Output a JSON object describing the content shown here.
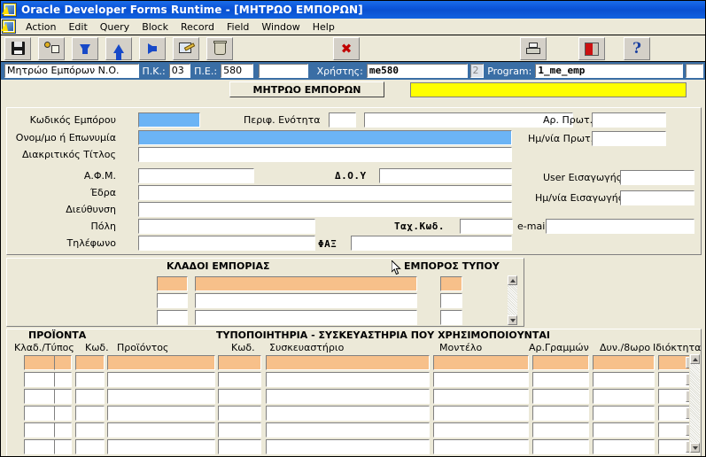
{
  "window": {
    "title": "Oracle Developer Forms Runtime - [ΜΗΤΡΩΟ ΕΜΠΟΡΩΝ]",
    "app_icon": "oracle-forms-icon"
  },
  "menubar": {
    "items": [
      {
        "label": "Action"
      },
      {
        "label": "Edit"
      },
      {
        "label": "Query"
      },
      {
        "label": "Block"
      },
      {
        "label": "Record"
      },
      {
        "label": "Field"
      },
      {
        "label": "Window"
      },
      {
        "label": "Help"
      }
    ]
  },
  "toolbar": {
    "buttons": [
      {
        "name": "save-button",
        "icon": "floppy-disk-icon"
      },
      {
        "name": "enter-query-button",
        "icon": "query-icon"
      },
      {
        "name": "next-record-button",
        "icon": "arrow-down-icon"
      },
      {
        "name": "previous-record-button",
        "icon": "arrow-up-icon"
      },
      {
        "name": "next-block-button",
        "icon": "arrow-right-icon"
      },
      {
        "name": "edit-button",
        "icon": "edit-pencil-icon"
      },
      {
        "name": "delete-record-button",
        "icon": "trash-icon"
      },
      {
        "name": "cancel-button",
        "icon": "red-x-icon"
      },
      {
        "name": "print-button",
        "icon": "printer-icon"
      },
      {
        "name": "exit-button",
        "icon": "exit-door-icon"
      },
      {
        "name": "help-button",
        "icon": "question-mark-icon"
      }
    ]
  },
  "statusbar": {
    "form_name": "Μητρώο Εμπόρων Ν.Ο.",
    "pk_label": "Π.Κ.:",
    "pk_value": "03",
    "pe_label": "Π.Ε.:",
    "pe_value": "580",
    "extra_value": "",
    "user_label": "Χρήστης:",
    "user_value": "me580",
    "seq_value": "2",
    "program_label": "Program:",
    "program_value": "1_me_emp",
    "tail_value": ""
  },
  "tab": {
    "label": "ΜΗΤΡΩΟ ΕΜΠΟΡΩΝ",
    "message_value": "",
    "message_color": "#ffff00"
  },
  "merchant": {
    "fields": [
      {
        "name": "merchant-code",
        "label": "Κωδικός Εμπόρου",
        "value": ""
      },
      {
        "name": "full-name",
        "label": "Ονομ/μο ή Επωνυμία",
        "value": ""
      },
      {
        "name": "distinctive-title",
        "label": "Διακριτικός Τίτλος",
        "value": ""
      },
      {
        "name": "afm",
        "label": "Α.Φ.Μ.",
        "value": ""
      },
      {
        "name": "headquarters",
        "label": "Έδρα",
        "value": ""
      },
      {
        "name": "address",
        "label": "Διεύθυνση",
        "value": ""
      },
      {
        "name": "city",
        "label": "Πόλη",
        "value": ""
      },
      {
        "name": "phone",
        "label": "Τηλέφωνο",
        "value": ""
      }
    ],
    "region_label": "Περιφ. Ενότητα",
    "region_code": "",
    "region_name": "",
    "doy_label": "Δ.Ο.Υ",
    "doy_value": "",
    "postal_label": "Ταχ.Κωδ.",
    "postal_value": "",
    "fax_label": "ΦΑΞ",
    "fax_value": "",
    "protocol_no_label": "Αρ. Πρωτ.",
    "protocol_no_value": "",
    "protocol_date_label": "Ημ/νία Πρωτ.",
    "protocol_date_value": "",
    "entry_user_label": "User Εισαγωγής",
    "entry_user_value": "",
    "entry_date_label": "Ημ/νία Εισαγωγής",
    "entry_date_value": "",
    "email_label": "e-mail",
    "email_value": ""
  },
  "branches": {
    "title": "ΚΛΑΔΟΙ ΕΜΠΟΡΙΑΣ",
    "press_title": "ΕΜΠΟΡΟΣ ΤΥΠΟΥ",
    "rows": [
      {
        "code": "",
        "description": "",
        "press": "",
        "current": true
      },
      {
        "code": "",
        "description": "",
        "press": "",
        "current": false
      },
      {
        "code": "",
        "description": "",
        "press": "",
        "current": false
      }
    ]
  },
  "products": {
    "section_title": "ΠΡΟΪΟΝΤΑ",
    "packaging_title": "ΤΥΠΟΠΟΙΗΤΗΡΙΑ - ΣΥΣΚΕΥΑΣΤΗΡΙΑ ΠΟΥ ΧΡΗΣΙΜΟΠΟΙΟΥΝΤΑΙ",
    "columns": [
      {
        "name": "col-branch-type",
        "label": "Κλαδ./Τύπος"
      },
      {
        "name": "col-code",
        "label": "Κωδ."
      },
      {
        "name": "col-product",
        "label": "Προϊόντος"
      },
      {
        "name": "col-pack-code",
        "label": "Κωδ."
      },
      {
        "name": "col-packer",
        "label": "Συσκευαστήριο"
      },
      {
        "name": "col-model",
        "label": "Μοντέλο"
      },
      {
        "name": "col-lines",
        "label": "Αρ.Γραμμών"
      },
      {
        "name": "col-capacity",
        "label": "Δυν./8ωρο"
      },
      {
        "name": "col-ownership",
        "label": "Ιδιόκτητα"
      }
    ],
    "rows": [
      {
        "branch_type": "",
        "code2": "",
        "code": "",
        "product": "",
        "pack_code": "",
        "packer": "",
        "model": "",
        "lines": "",
        "capacity": "",
        "ownership": "",
        "current": true
      },
      {
        "branch_type": "",
        "code2": "",
        "code": "",
        "product": "",
        "pack_code": "",
        "packer": "",
        "model": "",
        "lines": "",
        "capacity": "",
        "ownership": "",
        "current": false
      },
      {
        "branch_type": "",
        "code2": "",
        "code": "",
        "product": "",
        "pack_code": "",
        "packer": "",
        "model": "",
        "lines": "",
        "capacity": "",
        "ownership": "",
        "current": false
      },
      {
        "branch_type": "",
        "code2": "",
        "code": "",
        "product": "",
        "pack_code": "",
        "packer": "",
        "model": "",
        "lines": "",
        "capacity": "",
        "ownership": "",
        "current": false
      },
      {
        "branch_type": "",
        "code2": "",
        "code": "",
        "product": "",
        "pack_code": "",
        "packer": "",
        "model": "",
        "lines": "",
        "capacity": "",
        "ownership": "",
        "current": false
      },
      {
        "branch_type": "",
        "code2": "",
        "code": "",
        "product": "",
        "pack_code": "",
        "packer": "",
        "model": "",
        "lines": "",
        "capacity": "",
        "ownership": "",
        "current": false
      }
    ]
  },
  "colors": {
    "titlebar": "#0a52d8",
    "statusbar": "#3a6ea5",
    "current_record": "#6cb4f5",
    "current_row": "#f7c08a",
    "message": "#ffff00",
    "face": "#ece9d8"
  }
}
